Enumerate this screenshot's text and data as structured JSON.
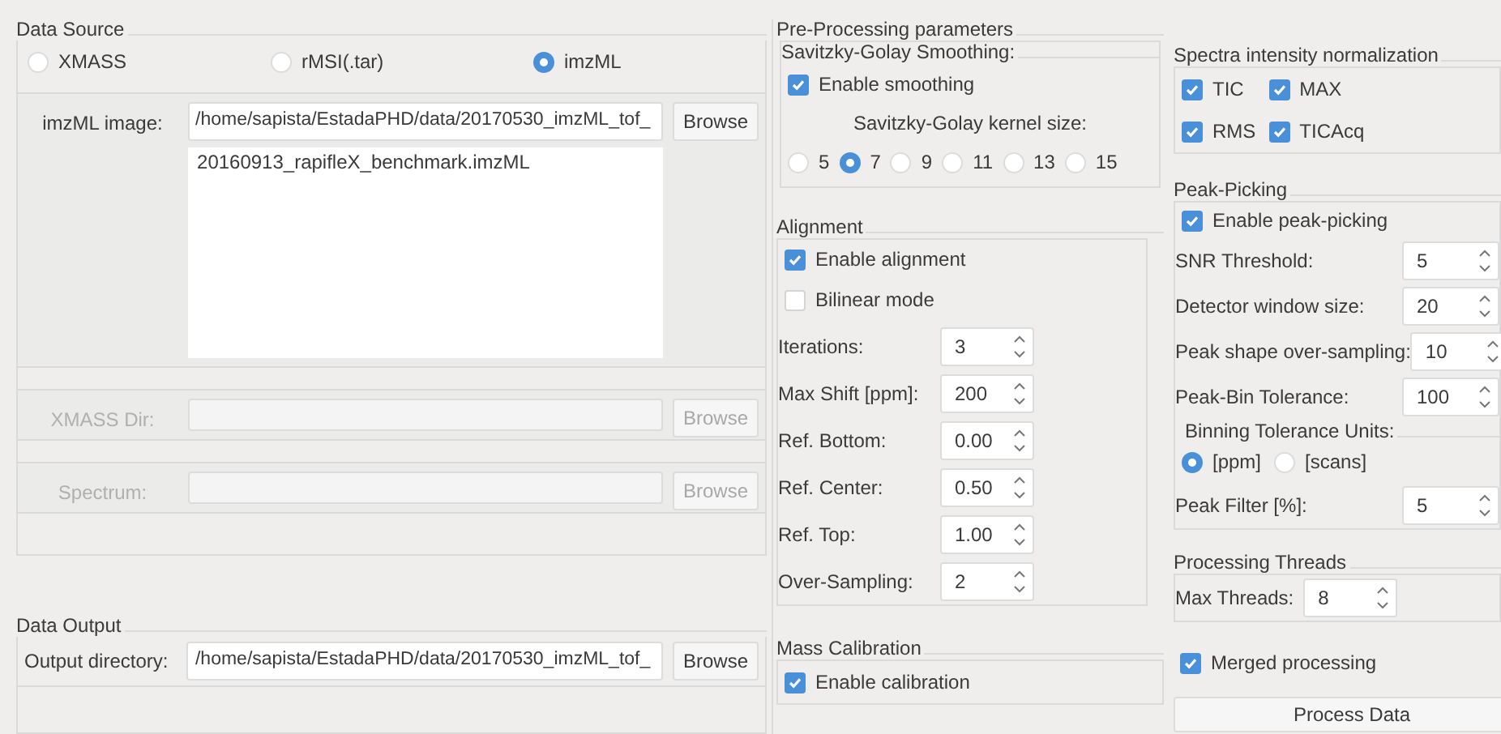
{
  "data_source": {
    "title": "Data Source",
    "options": [
      {
        "label": "XMASS",
        "selected": false
      },
      {
        "label": "rMSI(.tar)",
        "selected": false
      },
      {
        "label": "imzML",
        "selected": true
      }
    ],
    "inputs": [
      {
        "label": "imzML image:",
        "path": "/home/sapista/EstadaPHD/data/20170530_imzML_tof_",
        "browse": "Browse",
        "disabled": false,
        "files": [
          "20160913_rapifleX_benchmark.imzML"
        ]
      },
      {
        "label": "XMASS Dir:",
        "browse": "Browse",
        "disabled": true
      },
      {
        "label": "Spectrum:",
        "browse": "Browse",
        "disabled": true
      }
    ]
  },
  "data_output": {
    "title": "Data Output",
    "label": "Output directory:",
    "path": "/home/sapista/EstadaPHD/data/20170530_imzML_tof_",
    "browse": "Browse"
  },
  "preprocessing": {
    "title": "Pre-Processing parameters",
    "smoothing": {
      "title": "Savitzky-Golay Smoothing:",
      "enable": {
        "label": "Enable smoothing",
        "checked": true
      },
      "kernel_label": "Savitzky-Golay kernel size:",
      "kernel_options": [
        {
          "label": "5",
          "selected": false
        },
        {
          "label": "7",
          "selected": true
        },
        {
          "label": "9",
          "selected": false
        },
        {
          "label": "11",
          "selected": false
        },
        {
          "label": "13",
          "selected": false
        },
        {
          "label": "15",
          "selected": false
        }
      ]
    },
    "alignment": {
      "title": "Alignment",
      "enable": {
        "label": "Enable alignment",
        "checked": true
      },
      "bilinear": {
        "label": "Bilinear mode",
        "checked": false
      },
      "fields": [
        {
          "label": "Iterations:",
          "value": "3"
        },
        {
          "label": "Max Shift [ppm]:",
          "value": "200"
        },
        {
          "label": "Ref. Bottom:",
          "value": "0.00"
        },
        {
          "label": "Ref. Center:",
          "value": "0.50"
        },
        {
          "label": "Ref. Top:",
          "value": "1.00"
        },
        {
          "label": "Over-Sampling:",
          "value": "2"
        }
      ]
    },
    "calibration": {
      "title": "Mass Calibration",
      "enable": {
        "label": "Enable calibration",
        "checked": true
      }
    }
  },
  "normalization": {
    "title": "Spectra intensity normalization",
    "options": [
      {
        "label": "TIC",
        "checked": true
      },
      {
        "label": "MAX",
        "checked": true
      },
      {
        "label": "RMS",
        "checked": true
      },
      {
        "label": "TICAcq",
        "checked": true
      }
    ]
  },
  "peak_picking": {
    "title": "Peak-Picking",
    "enable": {
      "label": "Enable peak-picking",
      "checked": true
    },
    "fields": [
      {
        "label": "SNR Threshold:",
        "value": "5"
      },
      {
        "label": "Detector window size:",
        "value": "20"
      },
      {
        "label": "Peak shape over-sampling:",
        "value": "10"
      },
      {
        "label": "Peak-Bin Tolerance:",
        "value": "100"
      }
    ],
    "binning": {
      "title": "Binning Tolerance Units:",
      "options": [
        {
          "label": "[ppm]",
          "selected": true
        },
        {
          "label": "[scans]",
          "selected": false
        }
      ]
    },
    "filter": {
      "label": "Peak Filter [%]:",
      "value": "5"
    }
  },
  "threads": {
    "title": "Processing Threads",
    "label": "Max Threads:",
    "value": "8"
  },
  "merged": {
    "label": "Merged processing",
    "checked": true
  },
  "process_button": "Process Data"
}
